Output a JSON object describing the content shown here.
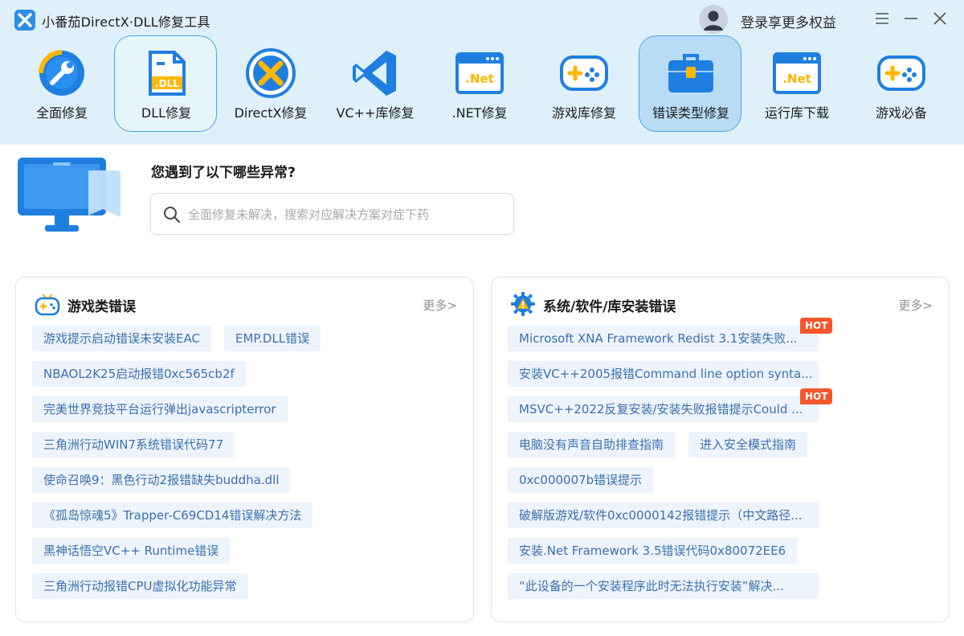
{
  "app": {
    "title": "小番茄DirectX·DLL修复工具",
    "login": "登录享更多权益"
  },
  "toolbar": [
    {
      "label": "全面修复",
      "icon": "wrench-gauge-icon"
    },
    {
      "label": "DLL修复",
      "icon": "dll-file-icon"
    },
    {
      "label": "DirectX修复",
      "icon": "directx-icon"
    },
    {
      "label": "VC++库修复",
      "icon": "vscode-icon"
    },
    {
      "label": ".NET修复",
      "icon": "dotnet-icon"
    },
    {
      "label": "游戏库修复",
      "icon": "gamepad-icon"
    },
    {
      "label": "错误类型修复",
      "icon": "toolbox-icon"
    },
    {
      "label": "运行库下载",
      "icon": "dotnet-runtime-icon"
    },
    {
      "label": "游戏必备",
      "icon": "gamepad-essential-icon"
    }
  ],
  "search": {
    "question": "您遇到了以下哪些异常?",
    "placeholder": "全面修复未解决，搜索对应解决方案对症下药"
  },
  "game_errors": {
    "title": "游戏类错误",
    "more": "更多>",
    "tags": [
      "游戏提示启动错误未安装EAC",
      "EMP.DLL错误",
      "NBAOL2K25启动报错0xc565cb2f",
      "完美世界竞技平台运行弹出javascripterror",
      "三角洲行动WIN7系统错误代码77",
      "使命召唤9：黑色行动2报错缺失buddha.dll",
      "《孤岛惊魂5》Trapper-C69CD14错误解决方法",
      "黑神话悟空VC++ Runtime错误",
      "三角洲行动报错CPU虚拟化功能异常"
    ]
  },
  "system_errors": {
    "title": "系统/软件/库安装错误",
    "more": "更多>",
    "hot_label": "HOT",
    "tags": [
      "Microsoft XNA Framework Redist 3.1安装失败...",
      "安装VC++2005报错Command line option synta...",
      "MSVC++2022反复安装/安装失败报错提示Could ...",
      "电脑没有声音自助排查指南",
      "进入安全模式指南",
      "0xc000007b错误提示",
      "破解版游戏/软件0xc0000142报错提示（中文路径...",
      "安装.Net Framework 3.5错误代码0x80072EE6",
      "“此设备的一个安装程序此时无法执行安装”解决..."
    ]
  }
}
